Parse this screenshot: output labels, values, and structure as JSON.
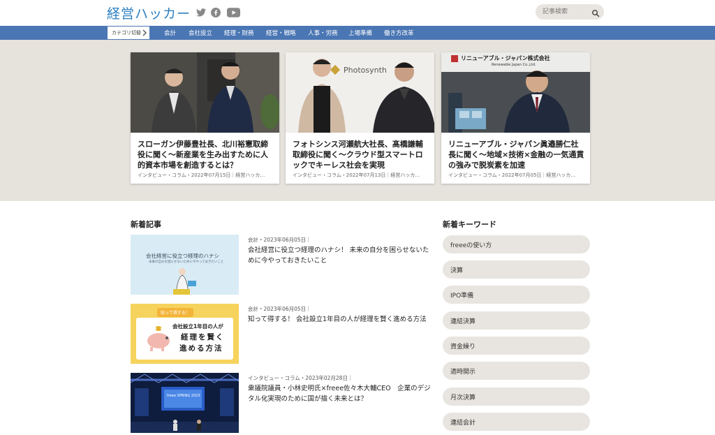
{
  "header": {
    "logo": "経営ハッカー",
    "search_placeholder": "記事検索",
    "social": [
      "twitter-icon",
      "facebook-icon",
      "youtube-icon"
    ]
  },
  "nav": {
    "category_switch": "カテゴリ切替",
    "items": [
      "会計",
      "会社設立",
      "経理・財務",
      "経営・戦略",
      "人事・労務",
      "上場準備",
      "働き方改革"
    ]
  },
  "featured": [
    {
      "title": "スローガン伊藤豊社長、北川裕憲取締役に聞く〜新産業を生み出すために人的資本市場を創造するとは？",
      "meta": "インタビュー・コラム・2022年07月15日｜経営ハッカ…"
    },
    {
      "title": "フォトシンス河瀬航大社長、髙橋謙輔取締役に聞く〜クラウド型スマートロックでキーレス社会を実現",
      "meta": "インタビュー・コラム・2022年07月13日｜経営ハッカ…",
      "image_text": "Photosynth"
    },
    {
      "title": "リニューアブル・ジャパン眞邉勝仁社長に聞く〜地域×技術×金融の一気通貫の強みで脱炭素を加速",
      "meta": "インタビュー・コラム・2022年07月05日｜経営ハッカ…",
      "image_text": "リニューアブル・ジャパン株式会社",
      "image_subtext": "Renewable Japan Co.,Ltd."
    }
  ],
  "new_articles": {
    "heading": "新着記事",
    "items": [
      {
        "meta": "会計・2023年06月05日｜",
        "title": "会社経営に役立つ経理のハナシ！ 未来の自分を困らせないために今やっておきたいこと",
        "thumb_text": "会社経営に役立つ経理のハナシ",
        "thumb_subtext": "未来の自分を困らせないために今やっておきたいこと"
      },
      {
        "meta": "会計・2023年06月05日｜",
        "title": "知って得する！ 会社設立1年目の人が経理を賢く進める方法",
        "thumb_badge": "知って得する！",
        "thumb_line1": "会社設立1年目の人が",
        "thumb_line2": "経理を賢く",
        "thumb_line3": "進める方法"
      },
      {
        "meta": "インタビュー・コラム・2023年02月28日｜",
        "title": "衆議院議員・小林史明氏×freee佐々木大輔CEO　企業のデジタル化実現のために国が描く未来とは？",
        "thumb_text": "freee SPRING 2023"
      }
    ]
  },
  "keywords": {
    "heading": "新着キーワード",
    "items": [
      "freeeの使い方",
      "決算",
      "IPO準備",
      "連結決算",
      "資金繰り",
      "適時開示",
      "月次決算",
      "連結会計"
    ]
  },
  "colors": {
    "nav": "#4a76b4",
    "logo": "#2c7fc1",
    "hero_bg": "#e6e2dc",
    "pill_bg": "#e8e5e0"
  }
}
